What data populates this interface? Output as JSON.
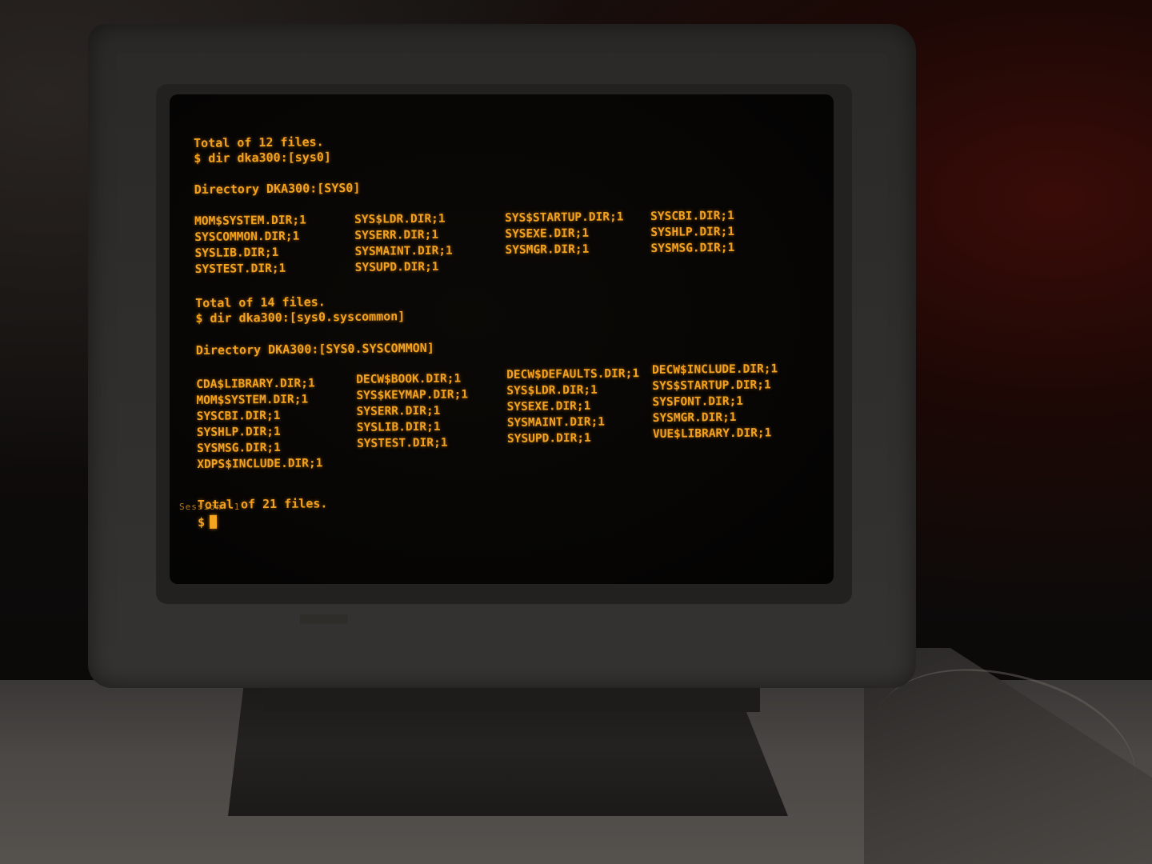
{
  "terminal": {
    "prompt_symbol": "$",
    "session_label": "Session  1",
    "lines": {
      "total_12": "Total of 12 files.",
      "cmd_1": "$ dir dka300:[sys0]",
      "dir_header_1": "Directory DKA300:[SYS0]",
      "total_14": "Total of 14 files.",
      "cmd_2": "$ dir dka300:[sys0.syscommon]",
      "dir_header_2": "Directory DKA300:[SYS0.SYSCOMMON]",
      "total_21": "Total of 21 files."
    },
    "listing_1": {
      "col1": [
        "MOM$SYSTEM.DIR;1",
        "SYSCOMMON.DIR;1",
        "SYSLIB.DIR;1",
        "SYSTEST.DIR;1"
      ],
      "col2": [
        "SYS$LDR.DIR;1",
        "SYSERR.DIR;1",
        "SYSMAINT.DIR;1",
        "SYSUPD.DIR;1"
      ],
      "col3": [
        "SYS$STARTUP.DIR;1",
        "SYSEXE.DIR;1",
        "SYSMGR.DIR;1"
      ],
      "col4": [
        "SYSCBI.DIR;1",
        "SYSHLP.DIR;1",
        "SYSMSG.DIR;1"
      ]
    },
    "listing_2": {
      "col1": [
        "CDA$LIBRARY.DIR;1",
        "MOM$SYSTEM.DIR;1",
        "SYSCBI.DIR;1",
        "SYSHLP.DIR;1",
        "SYSMSG.DIR;1",
        "XDPS$INCLUDE.DIR;1"
      ],
      "col2": [
        "DECW$BOOK.DIR;1",
        "SYS$KEYMAP.DIR;1",
        "SYSERR.DIR;1",
        "SYSLIB.DIR;1",
        "SYSTEST.DIR;1"
      ],
      "col3": [
        "DECW$DEFAULTS.DIR;1",
        "SYS$LDR.DIR;1",
        "SYSEXE.DIR;1",
        "SYSMAINT.DIR;1",
        "SYSUPD.DIR;1"
      ],
      "col4": [
        "DECW$INCLUDE.DIR;1",
        "SYS$STARTUP.DIR;1",
        "SYSFONT.DIR;1",
        "SYSMGR.DIR;1",
        "VUE$LIBRARY.DIR;1"
      ]
    }
  },
  "colors": {
    "phosphor": "#f2a21e",
    "bezel": "#2f2d2b"
  }
}
